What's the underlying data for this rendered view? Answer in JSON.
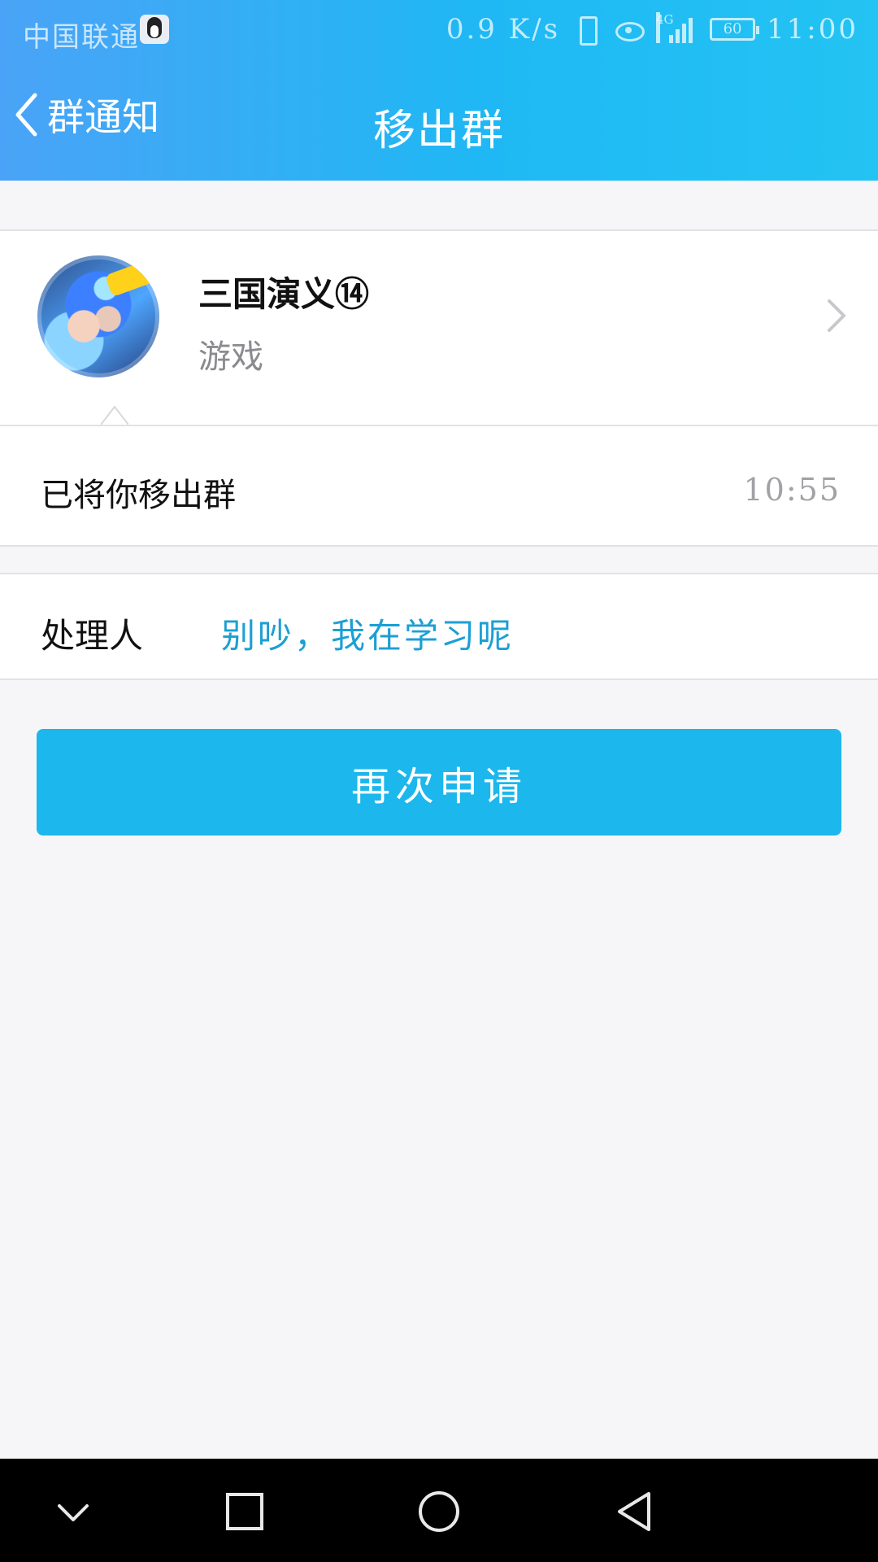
{
  "status_bar": {
    "carrier": "中国联通",
    "speed": "0.9 K/s",
    "network_badge": "4G",
    "battery_level": "60",
    "time": "11:00"
  },
  "header": {
    "back_label": "群通知",
    "title": "移出群"
  },
  "group": {
    "name": "三国演义⑭",
    "category": "游戏"
  },
  "notification": {
    "message": "已将你移出群",
    "time": "10:55"
  },
  "handler": {
    "label": "处理人",
    "name": "别吵，我在学习呢"
  },
  "actions": {
    "reapply_label": "再次申请"
  },
  "colors": {
    "header_gradient_start": "#4aa3f6",
    "header_gradient_end": "#23c3f3",
    "accent_blue": "#1cb7ec",
    "handler_name": "#1c9fd4",
    "background": "#f6f6f8"
  },
  "icons": {
    "carrier_app": "qq-icon",
    "status": [
      "vibrate-icon",
      "eye-icon",
      "signal-icon",
      "battery-icon"
    ],
    "back": "chevron-left-icon",
    "group_detail": "chevron-right-icon",
    "system_nav": [
      "chevron-down-icon",
      "square-icon",
      "circle-icon",
      "triangle-back-icon"
    ]
  }
}
